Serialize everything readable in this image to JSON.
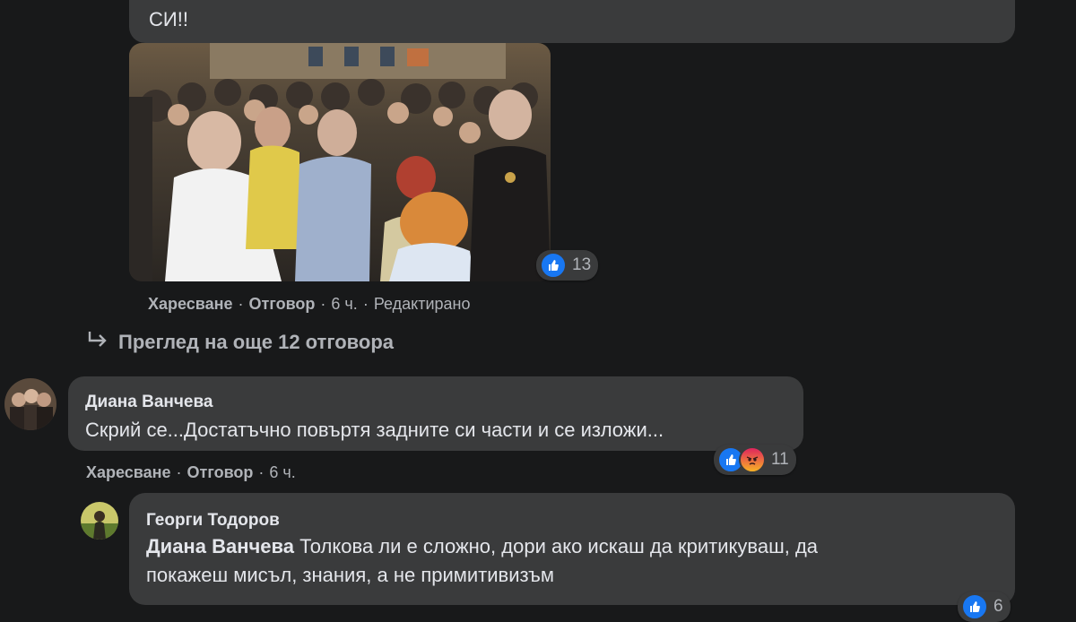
{
  "comment1": {
    "text_tail": "СИ!!",
    "reactions": {
      "count": "13",
      "icon": "like-icon"
    },
    "actions": {
      "like": "Харесване",
      "reply": "Отговор",
      "time": "6 ч.",
      "edited": "Редактирано"
    }
  },
  "more_replies": {
    "label": "Преглед на още 12 отговора",
    "icon": "reply-arrow-icon"
  },
  "comment2": {
    "author": "Диана Ванчева",
    "text": "Скрий се...Достатъчно повъртя задните си части и се изложи...",
    "reactions": {
      "count": "11",
      "icons": [
        "like-icon",
        "angry-icon"
      ]
    },
    "actions": {
      "like": "Харесване",
      "reply": "Отговор",
      "time": "6 ч."
    }
  },
  "comment3": {
    "author": "Георги Тодоров",
    "mention": "Диана Ванчева",
    "text_line1": " Толкова ли е сложно, дори ако искаш да критикуваш, да",
    "text_line2": "покажеш мисъл, знания, а не примитивизъм",
    "reactions": {
      "count": "6",
      "icon": "like-icon"
    }
  },
  "colors": {
    "background": "#18191a",
    "bubble": "#3a3b3c",
    "like": "#1877f2",
    "secondary_text": "#b0b3b8"
  }
}
